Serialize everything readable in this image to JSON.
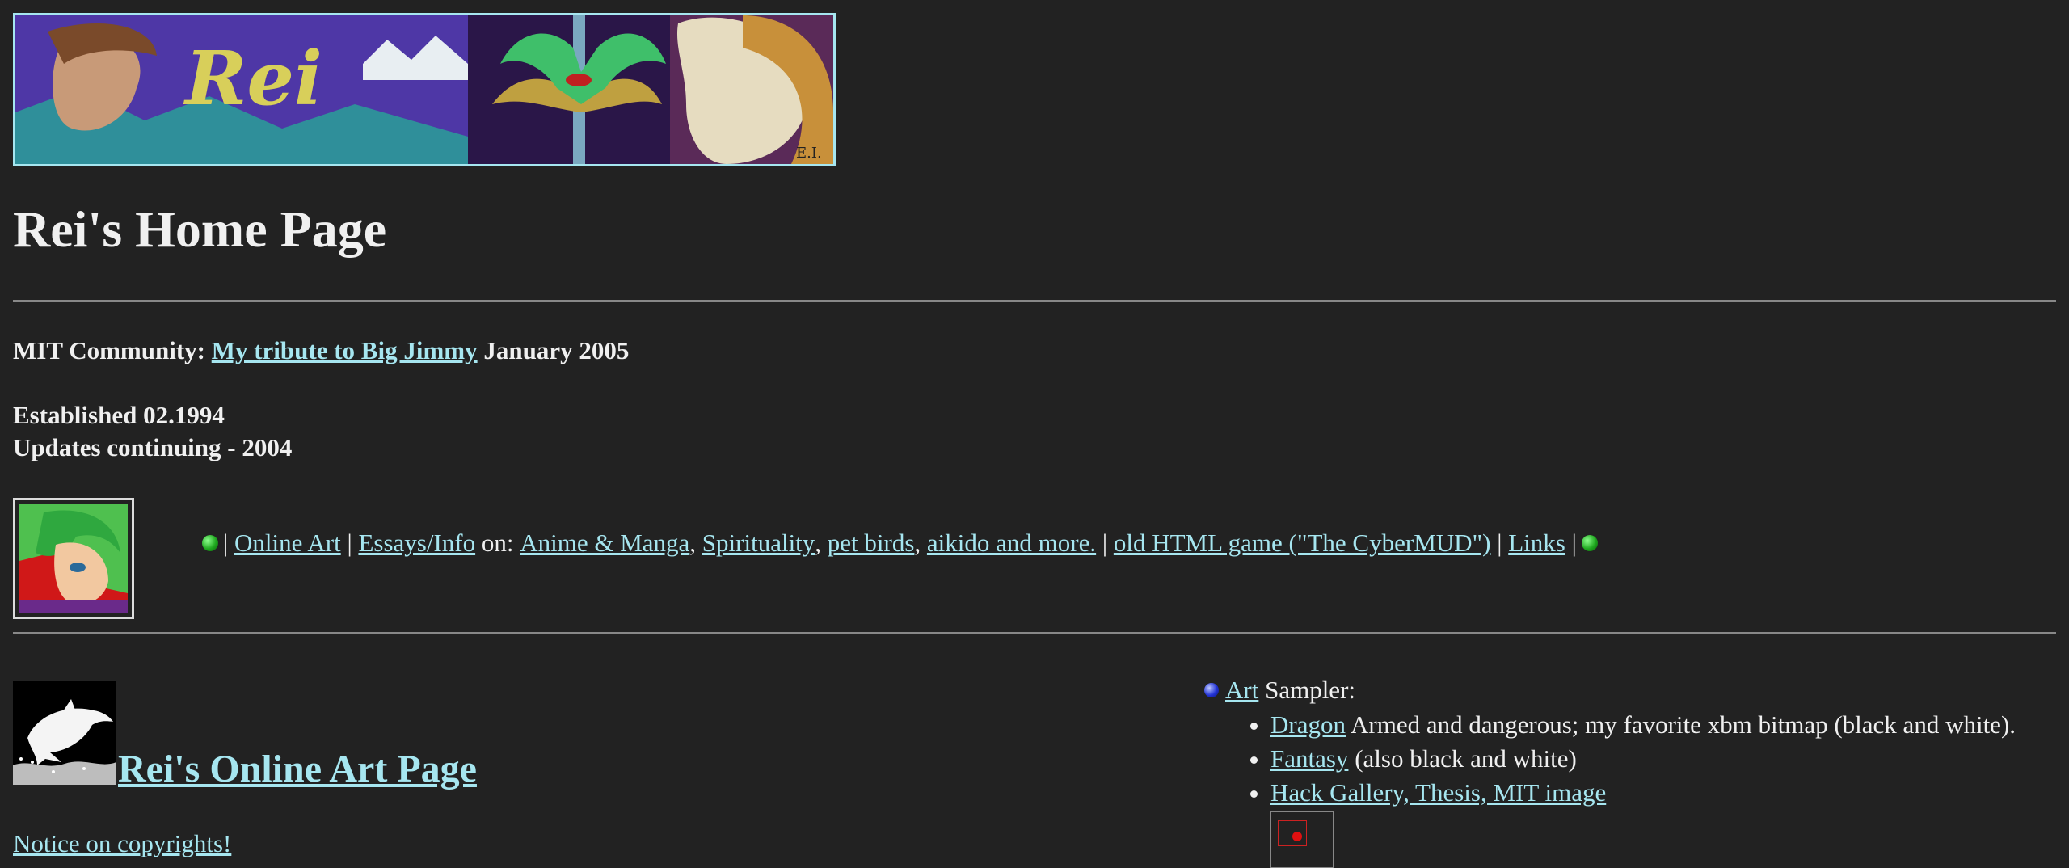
{
  "banner": {
    "logo_text": "Rei",
    "signature": "E.I."
  },
  "page_title": "Rei's Home Page",
  "mit": {
    "prefix": "MIT Community:",
    "link": "My tribute to Big Jimmy",
    "suffix": "January 2005"
  },
  "established": "Established 02.1994",
  "updates": "Updates continuing - 2004",
  "nav": {
    "sep": "|",
    "online_art": "Online Art",
    "essays": "Essays/Info",
    "on": "on:",
    "anime": "Anime & Manga",
    "spirituality": "Spirituality",
    "birds": "pet birds",
    "aikido": "aikido and more.",
    "game": "old HTML game (\"The CyberMUD\")",
    "links": "Links"
  },
  "art_section": {
    "heading": "Rei's Online Art Page",
    "notice": "Notice on copyrights!"
  },
  "sampler": {
    "link": "Art",
    "label": "Sampler:",
    "items": [
      {
        "link": "Dragon",
        "desc": "Armed and dangerous; my favorite xbm bitmap (black and white)."
      },
      {
        "link": "Fantasy",
        "desc": "(also black and white)"
      },
      {
        "link": "Hack Gallery, Thesis, MIT image",
        "desc": ""
      }
    ]
  },
  "colors": {
    "background": "#222222",
    "text": "#f0f0f0",
    "link": "#a6e6f0",
    "rule": "#888888",
    "banner_border": "#a6e6f0"
  },
  "icons": {
    "bullet_green": "green-ball-icon",
    "bullet_blue": "blue-ball-icon"
  }
}
